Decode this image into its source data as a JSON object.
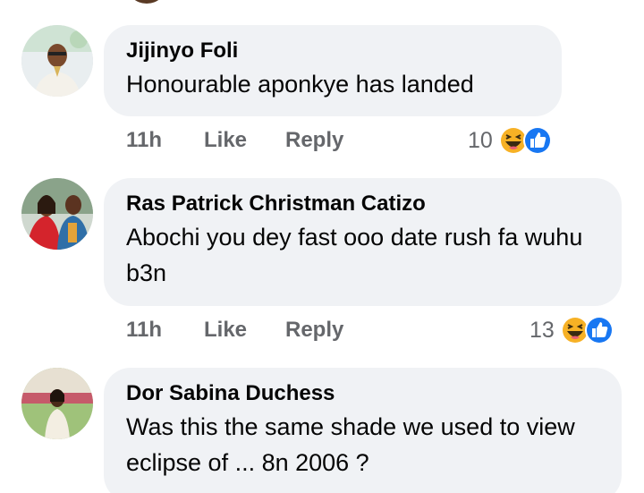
{
  "comments": [
    {
      "author": "Jijinyo Foli",
      "text": "Honourable aponkye has landed",
      "time": "11h",
      "like_label": "Like",
      "reply_label": "Reply",
      "reaction_count": "10",
      "reaction_icons": [
        "haha-icon",
        "like-icon"
      ]
    },
    {
      "author": "Ras Patrick Christman Catizo",
      "text": "Abochi you dey fast ooo date rush fa wuhu b3n",
      "time": "11h",
      "like_label": "Like",
      "reply_label": "Reply",
      "reaction_count": "13",
      "reaction_icons": [
        "haha-icon",
        "like-icon"
      ]
    },
    {
      "author": "Dor Sabina Duchess",
      "text": "Was this the same shade we used to view eclipse of ... 8n 2006 ?"
    }
  ],
  "colors": {
    "bubble_bg": "#f0f2f5",
    "text": "#050505",
    "secondary_text": "#65676b",
    "like_blue": "#1877f2",
    "haha_yellow": "#f7b125"
  }
}
